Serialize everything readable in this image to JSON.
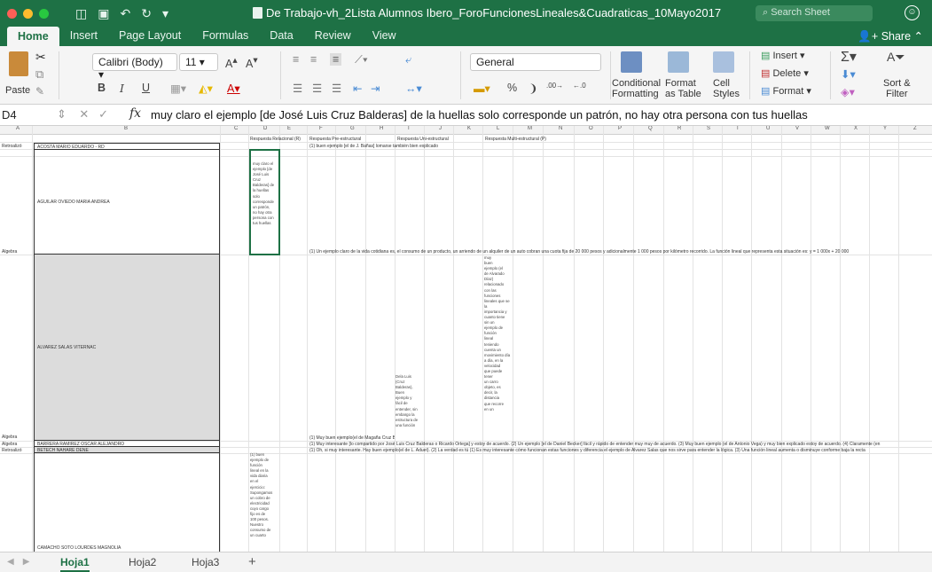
{
  "window": {
    "title": "De Trabajo-vh_2Lista Alumnos Ibero_ForoFuncionesLineales&Cuadraticas_10Mayo2017",
    "search_placeholder": "Search Sheet"
  },
  "ribbon_tabs": [
    "Home",
    "Insert",
    "Page Layout",
    "Formulas",
    "Data",
    "Review",
    "View"
  ],
  "share_label": "Share",
  "ribbon": {
    "paste": "Paste",
    "font_name": "Calibri (Body)",
    "font_size": "11",
    "bold": "B",
    "italic": "I",
    "underline": "U",
    "number_format": "General",
    "percent": "%",
    "conditional_formatting": "Conditional\nFormatting",
    "format_as_table": "Format\nas Table",
    "cell_styles": "Cell\nStyles",
    "insert": "Insert",
    "delete": "Delete",
    "format": "Format",
    "sort_filter": "Sort &\nFilter"
  },
  "formula_bar": {
    "name_box": "D4",
    "fx": "fx",
    "content": "muy claro el ejemplo [de José Luis Cruz Balderas] de la huellas solo corresponde un patrón, no hay otra persona con tus huellas"
  },
  "grid": {
    "columns": [
      "A",
      "B",
      "C",
      "D",
      "E",
      "F",
      "G",
      "H",
      "I",
      "J",
      "K",
      "L",
      "M",
      "N",
      "O",
      "P",
      "Q",
      "R",
      "S",
      "T",
      "U",
      "V",
      "W",
      "X",
      "Y",
      "Z"
    ],
    "headers": {
      "d": "Respuesta Relacional (R)",
      "f": "Respuesta Pre-estructural",
      "h": "Respuesta Uni-estructural",
      "l": "Respuesta Multi-estructural (P)"
    },
    "rows": [
      {
        "label": "Retroalizó",
        "name": "ACOSTA MARIO EDUARDO - RD"
      },
      {
        "label": "Algebra",
        "name": "AGUILAR OVIEDO MARIA ANDREA"
      },
      {
        "label": "Algebra",
        "name": "ALVAREZ SALAS VITERNAC"
      },
      {
        "label": "Algebra",
        "name": "BARRERA RAMIREZ OSCAR ALEJANDRO"
      },
      {
        "label": "Retroalizó",
        "name": "BETECH NAHARE DENE"
      },
      {
        "label": "",
        "name": "CAMACHO SOTO LOURDES MAGNOLIA"
      }
    ],
    "d4_text": "muy claro el\nejemplo [de\nJosé Luis\nCruz\nBalderas] de\nla huellas\nsolo\ncorresponde\nun patrón,\nno hay otra\npersona con\ntus huellas",
    "f3": "(1) buen ejemplo [el de J. Bañas] lomarse también bien explicado",
    "f4": "(1) Un ejemplo claro de la vida cotidiana es, el consumo de un producto, un arriendo de un alquiler de un auto cobran una cuota fija de 20 000 pesos y adicionalmente 1 000 pesos por kilómetro recorrido. La función lineal que representa esta situación es: y = 1 000x + 20 000",
    "h5_text": "Dela Luis\n(Cruz\nBalderas),\nBuen\nejemplo y\nfácil de\nentender, sin\nembargo la\nestructura de\nuna función",
    "l5_text": "muy\nbuen\nejemplo (el\nde Alvarado\nDíaz)\nrelacionado\ncon las\nfunciones\nlineales que se\nla\nimportancia y\ncuanto tiene\nsin un\nejemplo de\nfunción\nlineal\nteniendo\ncuenta un\nmovimiento día\na día, en la\nvelocidad\nque puede\ntener\nun carro\nobjeto, es\ndecir, la\ndistancia\nque recorre\nen un",
    "f5": "(1) Muy buen ejemplo(el de Magaña Cruz Balder)",
    "f6": "(1) Muy interesante [lo compartido por José Luis Cruz Balderas o Ricardo Ortega] y estoy de acuerdo. (2) Un ejemplo [el de Daniel Becker] fácil y rápido de entender muy muy de acuerdo. (3) Muy buen ejemplo (el de Antonio Vega) y muy bien explicado estoy de acuerdo. (4) Claramente (en",
    "f7": "(1) Oh, si muy interesante. Hay buen ejemplo(el de L. Aduet). (2) La verdad es tú (1) Es muy interesante cómo funcionan estas funciones y diferencia el ejemplo de Alvarez Salas que nos sirve para entender la lógica. (3) Una función lineal aumenta o disminuye conforme baja la recta",
    "d7_text": "(1) buen\nejemplo de\nfunción\nlineal en la\nvida diaria\nen el\nejercicio:\nSupongamos\nun cobro de\nelectricidad\ncuyo cargo\nfijo es de\n100 pesos.\nNuestro\nconsumo de\nun cuarto"
  },
  "sheets": [
    "Hoja1",
    "Hoja2",
    "Hoja3"
  ],
  "active_sheet": "Hoja1",
  "colors": {
    "excel_green": "#1e7145",
    "ribbon_bg": "#f5f5f5",
    "name_cell_grey": "#dcdcdc"
  }
}
